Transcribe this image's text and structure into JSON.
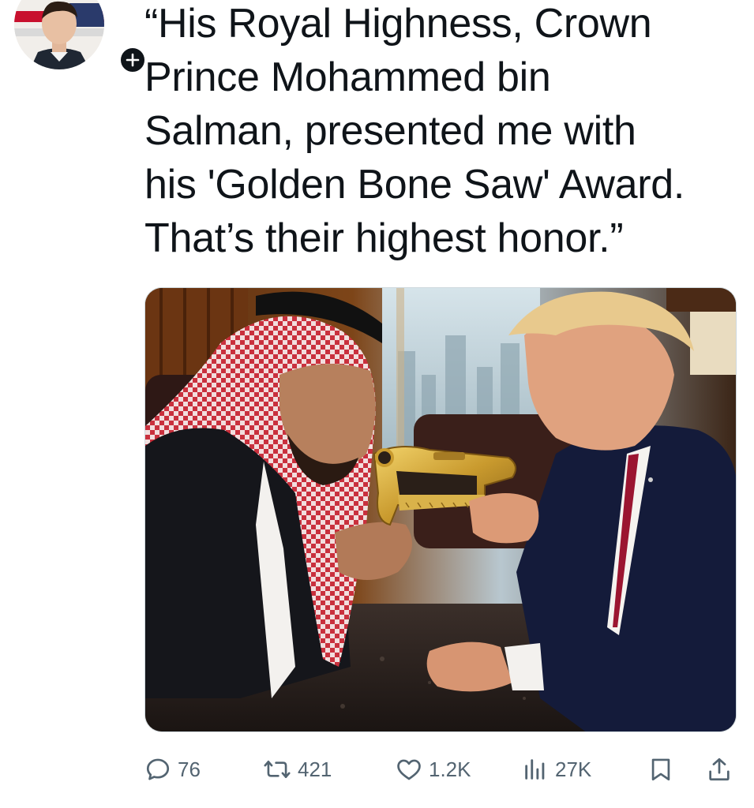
{
  "tweet": {
    "text": "“His Royal Highness, Crown\nPrince Mohammed bin\nSalman, presented me with\nhis 'Golden Bone Saw' Award.\nThat’s their highest honor.”"
  },
  "actions": {
    "replies": "76",
    "retweets": "421",
    "likes": "1.2K",
    "views": "27K"
  },
  "icons": {
    "reply": "comment-bubble-icon",
    "retweet": "retweet-arrows-icon",
    "like": "heart-icon",
    "views": "bar-chart-icon",
    "bookmark": "bookmark-icon",
    "share": "share-upload-icon",
    "follow": "plus-icon"
  },
  "colors": {
    "text": "#0f1419",
    "muted": "#536471",
    "border": "#cfd9de"
  }
}
